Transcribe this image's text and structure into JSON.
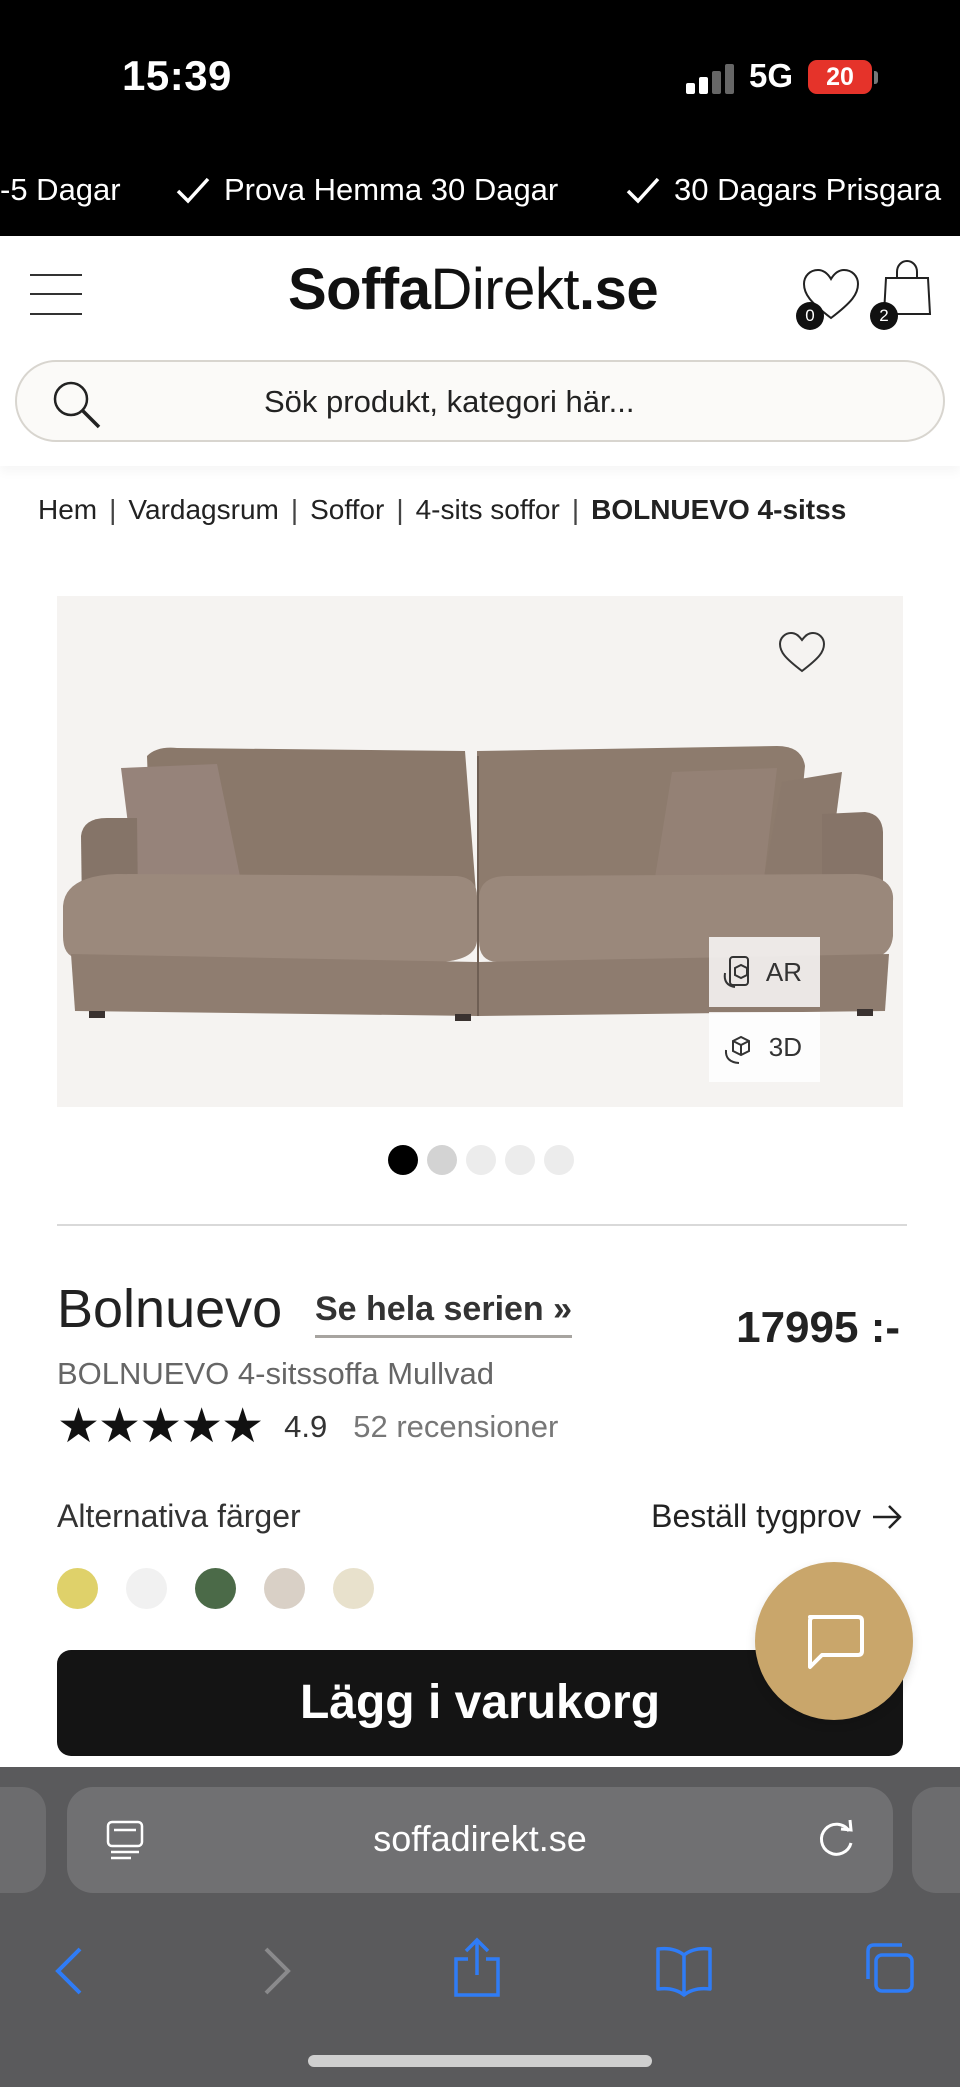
{
  "status_bar": {
    "time": "15:39",
    "network": "5G",
    "battery": "20"
  },
  "usp_banner": {
    "items": [
      "-5 Dagar",
      "Prova Hemma 30 Dagar",
      "30 Dagars Prisgara"
    ]
  },
  "header": {
    "logo_bold": "Soffa",
    "logo_regular": "Direkt",
    "logo_tld": ".se",
    "wishlist_count": "0",
    "cart_count": "2"
  },
  "search": {
    "placeholder": "Sök produkt, kategori här..."
  },
  "breadcrumb": {
    "items": [
      "Hem",
      "Vardagsrum",
      "Soffor",
      "4-sits soffor"
    ],
    "current": "BOLNUEVO 4-sitss"
  },
  "gallery": {
    "ar_label": "AR",
    "threed_label": "3D",
    "image_count": 5,
    "active_index": 0
  },
  "product": {
    "name": "Bolnuevo",
    "series_link": "Se hela serien »",
    "price": "17995 :-",
    "variant": "BOLNUEVO 4-sitssoffa Mullvad",
    "stars": "★★★★★",
    "rating": "4.9",
    "reviews": "52 recensioner",
    "alt_colors_label": "Alternativa färger",
    "order_sample_label": "Beställ tygprov",
    "swatches": [
      "#dfd16a",
      "#f1f1f1",
      "#4b6a48",
      "#d9d0c6",
      "#e8e1cc"
    ],
    "add_to_cart": "Lägg i varukorg"
  },
  "browser": {
    "url": "soffadirekt.se"
  },
  "colors": {
    "accent_gold": "#c9a66b",
    "sofa": "#8e7c6e"
  }
}
